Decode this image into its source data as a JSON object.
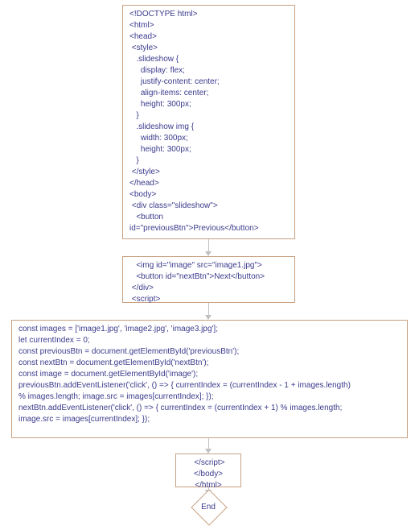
{
  "diagram": {
    "type": "flowchart",
    "nodes": [
      {
        "id": "n1",
        "text": "<!DOCTYPE html>\n<html>\n<head>\n <style>\n   .slideshow {\n     display: flex;\n     justify-content: center;\n     align-items: center;\n     height: 300px;\n   }\n   .slideshow img {\n     width: 300px;\n     height: 300px;\n   }\n </style>\n</head>\n<body>\n <div class=\"slideshow\">\n   <button\nid=\"previousBtn\">Previous</button>"
      },
      {
        "id": "n2",
        "text": "   <img id=\"image\" src=\"image1.jpg\">\n   <button id=\"nextBtn\">Next</button>\n </div>\n <script>"
      },
      {
        "id": "n3",
        "text": "const images = ['image1.jpg', 'image2.jpg', 'image3.jpg'];\nlet currentIndex = 0;\nconst previousBtn = document.getElementById('previousBtn');\nconst nextBtn = document.getElementById('nextBtn');\nconst image = document.getElementById('image');\npreviousBtn.addEventListener('click', () => { currentIndex = (currentIndex - 1 + images.length)\n% images.length; image.src = images[currentIndex]; });\nnextBtn.addEventListener('click', () => { currentIndex = (currentIndex + 1) % images.length;\nimage.src = images[currentIndex]; });"
      },
      {
        "id": "n4",
        "text": " </script>\n</body>\n</html>"
      }
    ],
    "end_label": "End",
    "edges": [
      {
        "from": "n1",
        "to": "n2"
      },
      {
        "from": "n2",
        "to": "n3"
      },
      {
        "from": "n3",
        "to": "n4"
      },
      {
        "from": "n4",
        "to": "end"
      }
    ]
  }
}
